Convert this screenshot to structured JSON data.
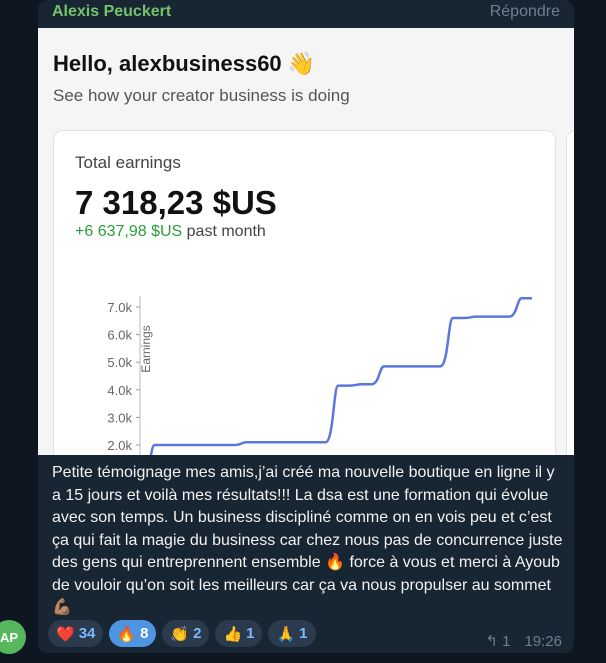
{
  "message": {
    "sender": "Alexis Peuckert",
    "reply_label": "Répondre",
    "text": "Petite témoignage mes amis,j’ai créé ma nouvelle boutique en ligne il y a 15 jours et voilà mes résultats!!! La dsa est une formation qui évolue avec son temps. Un business discipliné comme on en vois peu et c’est ça qui fait la magie du business car chez nous pas de concurrence juste des gens qui entreprennent ensemble 🔥 force à vous et merci à Ayoub de vouloir qu’on soit les meilleurs car ça va nous propulser au sommet 💪🏽",
    "time": "19:26",
    "reply_count": "1",
    "avatar_initials": "AP"
  },
  "screenshot": {
    "greeting": "Hello, alexbusiness60 👋",
    "subtitle": "See how your creator business is doing",
    "card_title": "Total earnings",
    "amount": "7 318,23 $US",
    "delta_value": "+6 637,98 $US",
    "delta_suffix": " past month"
  },
  "reactions": [
    {
      "emoji": "❤️",
      "count": "34",
      "selected": false
    },
    {
      "emoji": "🔥",
      "count": "8",
      "selected": true
    },
    {
      "emoji": "👏",
      "count": "2",
      "selected": false
    },
    {
      "emoji": "👍",
      "count": "1",
      "selected": false
    },
    {
      "emoji": "🙏",
      "count": "1",
      "selected": false
    }
  ],
  "chart_data": {
    "type": "line",
    "ylabel": "Earnings",
    "yticks": [
      "2.0k",
      "3.0k",
      "4.0k",
      "5.0k",
      "6.0k",
      "7.0k"
    ],
    "x": [
      0,
      1,
      2,
      3,
      4,
      5,
      6,
      7,
      8,
      9,
      10,
      11,
      12,
      13,
      14,
      15,
      16,
      17
    ],
    "values": [
      680,
      2000,
      2000,
      2000,
      2000,
      2100,
      2100,
      2100,
      2100,
      4150,
      4200,
      4850,
      4850,
      4850,
      6600,
      6650,
      6650,
      7318
    ],
    "ylim": [
      1500,
      7500
    ],
    "color": "#5b77d9"
  }
}
